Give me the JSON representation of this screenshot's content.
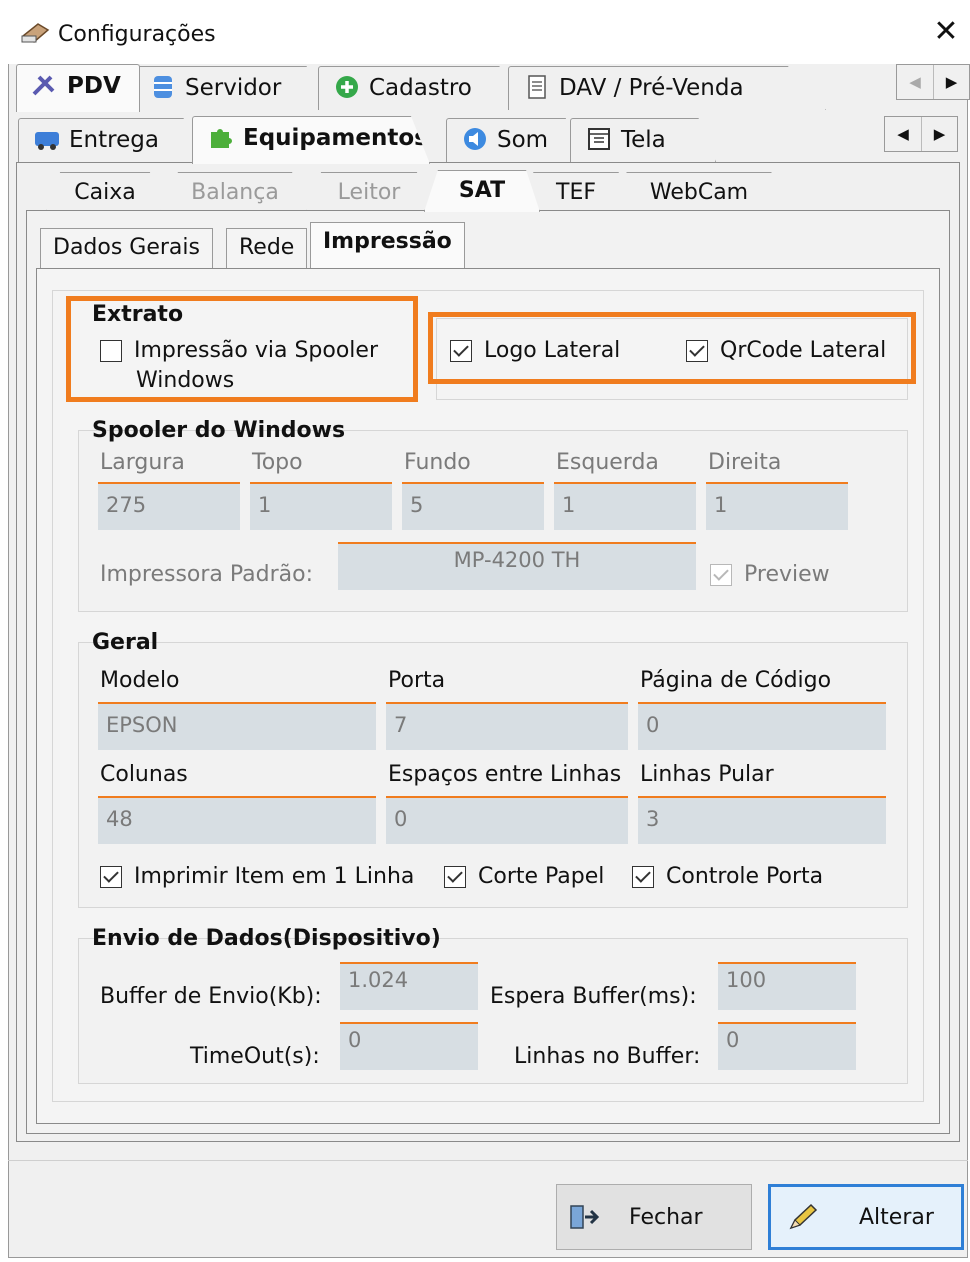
{
  "window": {
    "title": "Configurações"
  },
  "tabs_row1": [
    "PDV",
    "Servidor",
    "Cadastro",
    "DAV / Pré-Venda"
  ],
  "tabs_row2": [
    "Entrega",
    "Equipamentos",
    "Som",
    "Tela"
  ],
  "sub_tabs": [
    "Caixa",
    "Balança",
    "Leitor",
    "SAT",
    "TEF",
    "WebCam"
  ],
  "panel_tabs": [
    "Dados Gerais",
    "Rede",
    "Impressão"
  ],
  "extrato": {
    "title": "Extrato",
    "spooler_line1": "Impressão via Spooler",
    "spooler_line2": "Windows",
    "logo_lateral": "Logo Lateral",
    "qrcode_lateral": "QrCode Lateral"
  },
  "spooler": {
    "title": "Spooler do Windows",
    "labels": [
      "Largura",
      "Topo",
      "Fundo",
      "Esquerda",
      "Direita"
    ],
    "values": [
      "275",
      "1",
      "5",
      "1",
      "1"
    ],
    "impressora_label": "Impressora Padrão:",
    "impressora_value": "MP-4200 TH",
    "preview": "Preview"
  },
  "geral": {
    "title": "Geral",
    "modelo_label": "Modelo",
    "modelo_value": "EPSON",
    "porta_label": "Porta",
    "porta_value": "7",
    "pagina_label": "Página de Código",
    "pagina_value": "0",
    "colunas_label": "Colunas",
    "colunas_value": "48",
    "espacos_label": "Espaços entre Linhas",
    "espacos_value": "0",
    "pular_label": "Linhas Pular",
    "pular_value": "3",
    "imprimir_item": "Imprimir Item em 1 Linha",
    "corte_papel": "Corte Papel",
    "controle_porta": "Controle Porta"
  },
  "envio": {
    "title": "Envio de Dados(Dispositivo)",
    "buffer_label": "Buffer de Envio(Kb):",
    "buffer_value": "1.024",
    "espera_label": "Espera Buffer(ms):",
    "espera_value": "100",
    "timeout_label": "TimeOut(s):",
    "timeout_value": "0",
    "linhas_label": "Linhas no Buffer:",
    "linhas_value": "0"
  },
  "buttons": {
    "fechar": "Fechar",
    "alterar": "Alterar"
  },
  "colors": {
    "accent": "#f07c1e",
    "field_bg": "#d7dee3",
    "primary_border": "#2f7fd6"
  }
}
